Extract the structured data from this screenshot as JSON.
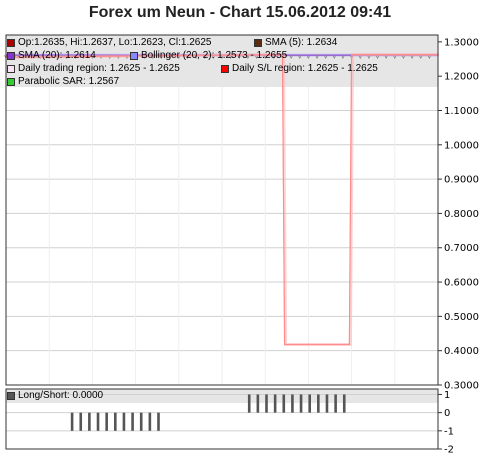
{
  "title": "Forex um Neun - Chart 15.06.2012 09:41",
  "colors": {
    "background": "#ffffff",
    "plot_border": "#333333",
    "grid": "#d0d0d0",
    "legend_bg": "#e6e6e6",
    "price_line": "#ff6b6b",
    "bollinger": "#9999ff",
    "sma20": "#8833cc",
    "sar": "#888888",
    "bars": "#555555"
  },
  "legend": [
    {
      "label": "Op:1.2635, Hi:1.2637, Lo:1.2623, Cl:1.2625",
      "color": "#aa0000"
    },
    {
      "label": "SMA (5): 1.2634",
      "color": "#5b2b12"
    },
    {
      "label": "SMA (20): 1.2614",
      "color": "#8833cc"
    },
    {
      "label": "Bollinger (20, 2): 1.2573 - 1.2655",
      "color": "#8888ff"
    },
    {
      "label": "Daily trading region: 1.2625 - 1.2625",
      "color": "#f4e4f4"
    },
    {
      "label": "Daily S/L region: 1.2625 - 1.2625",
      "color": "#ff0000"
    },
    {
      "label": "Parabolic SAR: 1.2567",
      "color": "#33cc33"
    }
  ],
  "sub_legend": {
    "label": "Long/Short: 0.0000",
    "color": "#555555"
  },
  "chart_data": [
    {
      "type": "line",
      "title": "Forex um Neun - Chart 15.06.2012 09:41",
      "ylim": [
        0.3,
        1.32
      ],
      "yticks": [
        "1.3000",
        "1.2000",
        "1.1000",
        "1.0000",
        "0.9000",
        "0.8000",
        "0.7000",
        "0.6000",
        "0.5000",
        "0.4000",
        "0.3000"
      ],
      "ytick_values": [
        1.3,
        1.2,
        1.1,
        1.0,
        0.9,
        0.8,
        0.7,
        0.6,
        0.5,
        0.4,
        0.3
      ],
      "grid": true,
      "legend_position": "top-left",
      "x_count": 100,
      "series": [
        {
          "name": "Op:1.2635, Hi:1.2637, Lo:1.2623, Cl:1.2625",
          "points": [
            [
              0,
              1.255
            ],
            [
              63,
              1.263
            ],
            [
              64,
              1.263
            ],
            [
              64.5,
              0.418
            ],
            [
              79.5,
              0.418
            ],
            [
              80,
              1.263
            ],
            [
              100,
              1.263
            ]
          ]
        }
      ]
    },
    {
      "type": "bar",
      "ylim": [
        -2,
        1.3
      ],
      "yticks": [
        "1",
        "0",
        "-1",
        "-2"
      ],
      "ytick_values": [
        1,
        0,
        -1,
        -2
      ],
      "groups": [
        {
          "value": -1,
          "from": 15,
          "to": 36
        },
        {
          "value": 1,
          "from": 56,
          "to": 80
        }
      ]
    }
  ]
}
